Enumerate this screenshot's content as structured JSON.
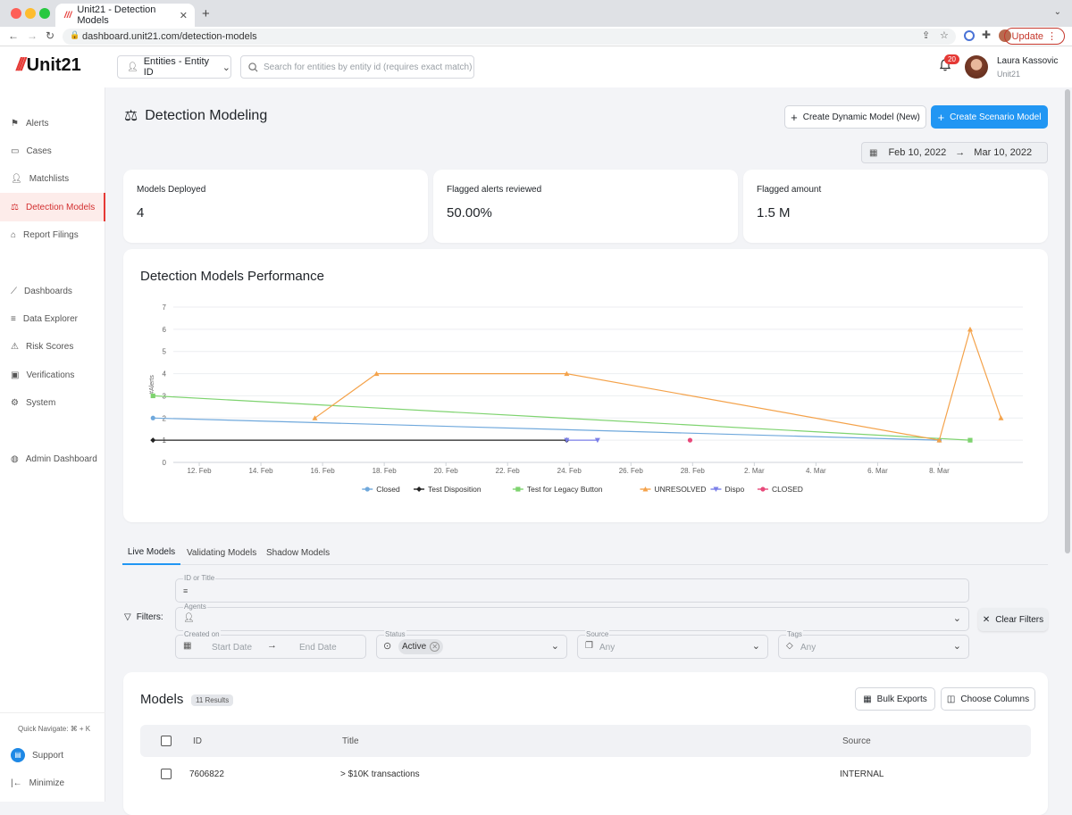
{
  "browser": {
    "tab_title": "Unit21 - Detection Models",
    "url": "dashboard.unit21.com/detection-models",
    "update_label": "Update"
  },
  "header": {
    "logo": "Unit21",
    "entity_selector": "Entities - Entity ID",
    "search_placeholder": "Search for entities by entity id (requires exact match)",
    "notification_count": "20",
    "user_name": "Laura Kassovic",
    "user_org": "Unit21"
  },
  "sidebar": {
    "items": [
      {
        "label": "Alerts",
        "icon": "flag-icon"
      },
      {
        "label": "Cases",
        "icon": "briefcase-icon"
      },
      {
        "label": "Matchlists",
        "icon": "user-plus-icon"
      },
      {
        "label": "Detection Models",
        "icon": "scale-icon"
      },
      {
        "label": "Report Filings",
        "icon": "bank-icon"
      },
      {
        "label": "Dashboards",
        "icon": "chart-line-icon"
      },
      {
        "label": "Data Explorer",
        "icon": "data-search-icon"
      },
      {
        "label": "Risk Scores",
        "icon": "warning-icon"
      },
      {
        "label": "Verifications",
        "icon": "id-card-icon"
      },
      {
        "label": "System",
        "icon": "gear-icon"
      },
      {
        "label": "Admin Dashboard",
        "icon": "globe-icon"
      }
    ],
    "quick_navigate": "Quick Navigate: ⌘ + K",
    "support": "Support",
    "minimize": "Minimize"
  },
  "page": {
    "title": "Detection Modeling",
    "create_dynamic": "Create Dynamic Model (New)",
    "create_scenario": "Create Scenario Model",
    "date_start": "Feb 10, 2022",
    "date_end": "Mar 10, 2022"
  },
  "stats": [
    {
      "label": "Models Deployed",
      "value": "4"
    },
    {
      "label": "Flagged alerts reviewed",
      "value": "50.00%"
    },
    {
      "label": "Flagged amount",
      "value": "1.5 M"
    }
  ],
  "chart_data": {
    "type": "line",
    "title": "Detection Models Performance",
    "ylabel": "#Alerts",
    "xlabel": "",
    "ylim": [
      0,
      7
    ],
    "y_ticks": [
      "0",
      "1",
      "2",
      "3",
      "4",
      "5",
      "6",
      "7"
    ],
    "x_ticks": [
      "12. Feb",
      "14. Feb",
      "16. Feb",
      "18. Feb",
      "20. Feb",
      "22. Feb",
      "24. Feb",
      "26. Feb",
      "28. Feb",
      "2. Mar",
      "4. Mar",
      "6. Mar",
      "8. Mar"
    ],
    "grid": true,
    "legend": "bottom",
    "series": [
      {
        "name": "Closed",
        "color": "#6fa8dc",
        "marker": "circle",
        "points": [
          [
            "2022-02-10T12:00",
            2
          ],
          [
            "2022-03-08",
            1
          ]
        ]
      },
      {
        "name": "Test Disposition",
        "color": "#222222",
        "marker": "diamond",
        "points": [
          [
            "2022-02-10T12:00",
            1
          ],
          [
            "2022-02-23T22:00",
            1
          ]
        ]
      },
      {
        "name": "Test for Legacy Button",
        "color": "#7ed36f",
        "marker": "square",
        "points": [
          [
            "2022-02-10T12:00",
            3
          ],
          [
            "2022-03-09",
            1
          ]
        ]
      },
      {
        "name": "UNRESOLVED",
        "color": "#f4a24a",
        "marker": "triangle",
        "points": [
          [
            "2022-02-15T18:00",
            2
          ],
          [
            "2022-02-17T18:00",
            4
          ],
          [
            "2022-02-23T22:00",
            4
          ],
          [
            "2022-03-08",
            1
          ],
          [
            "2022-03-09",
            6
          ],
          [
            "2022-03-10",
            2
          ]
        ]
      },
      {
        "name": "Dispo",
        "color": "#7b7fe8",
        "marker": "triangle-down",
        "points": [
          [
            "2022-02-23T22:00",
            1
          ],
          [
            "2022-02-24T22:00",
            1
          ]
        ]
      },
      {
        "name": "CLOSED",
        "color": "#e8497a",
        "marker": "circle",
        "points": [
          [
            "2022-02-27T22:00",
            1
          ]
        ]
      }
    ]
  },
  "tabs": [
    "Live Models",
    "Validating Models",
    "Shadow Models"
  ],
  "filters": {
    "label": "Filters:",
    "id_title_label": "ID or Title",
    "agents_label": "Agents",
    "created_on_label": "Created on",
    "start_date": "Start Date",
    "end_date": "End Date",
    "status_label": "Status",
    "status_value": "Active",
    "source_label": "Source",
    "source_value": "Any",
    "tags_label": "Tags",
    "tags_value": "Any",
    "clear": "Clear Filters"
  },
  "models": {
    "title": "Models",
    "count": "11 Results",
    "bulk_exports": "Bulk Exports",
    "choose_columns": "Choose Columns",
    "columns": [
      "ID",
      "Title",
      "Source"
    ],
    "rows": [
      {
        "id": "7606822",
        "title": "> $10K transactions",
        "source": "INTERNAL"
      }
    ]
  }
}
